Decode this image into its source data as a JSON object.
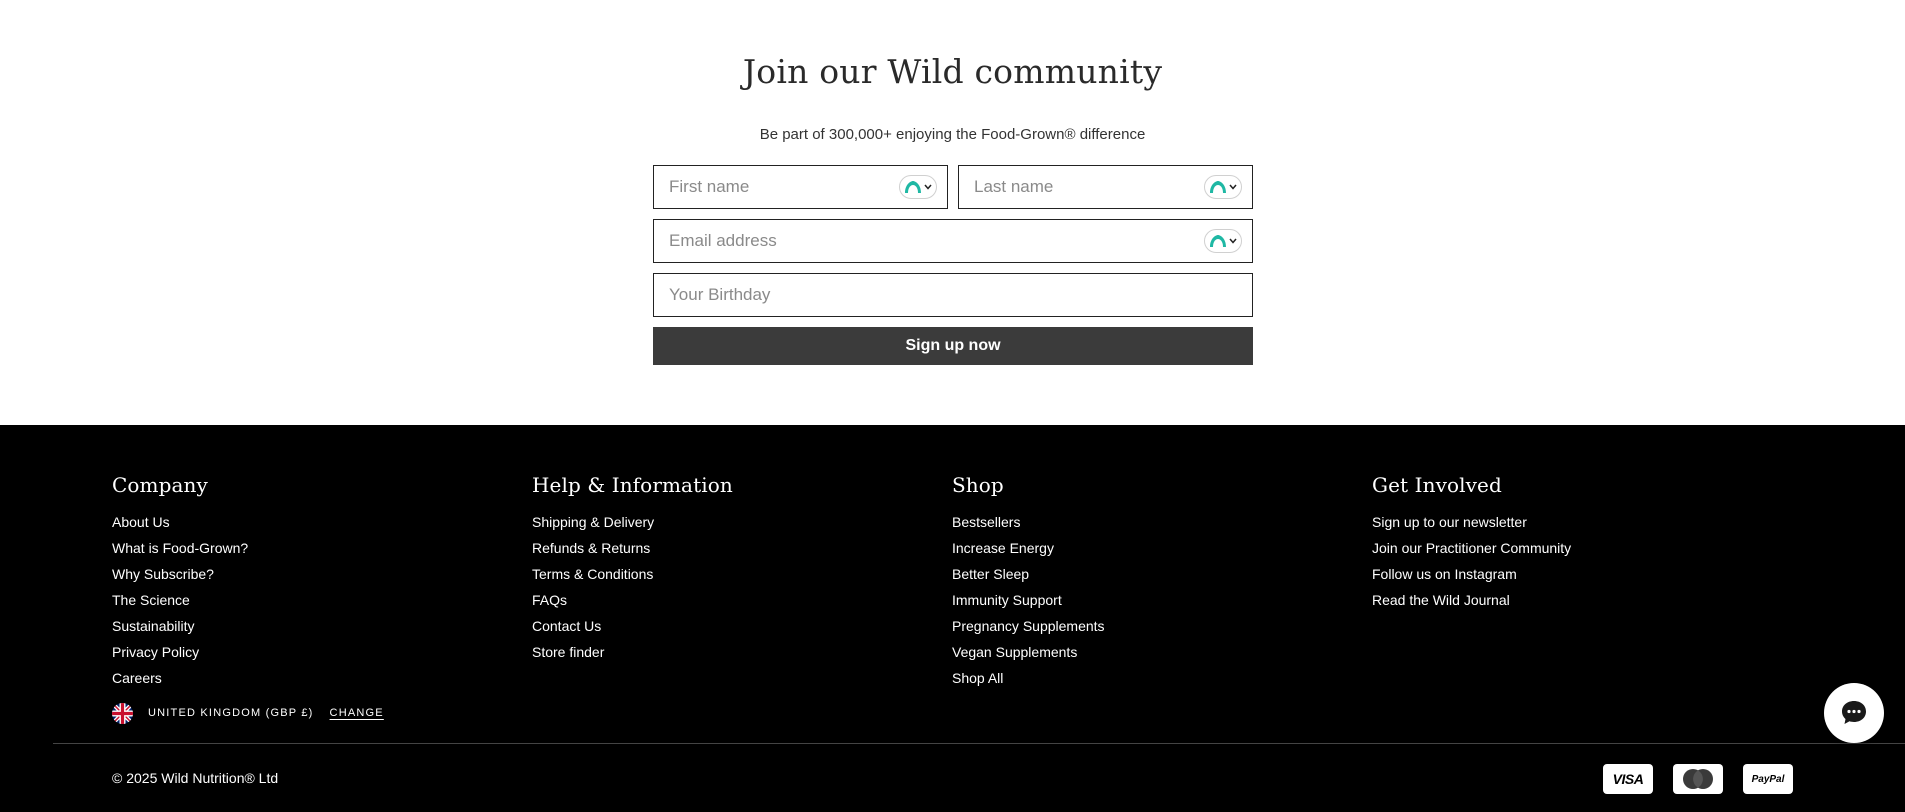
{
  "signup": {
    "title": "Join our Wild community",
    "subtitle": "Be part of 300,000+ enjoying the Food-Grown® difference",
    "first_name_placeholder": "First name",
    "last_name_placeholder": "Last name",
    "email_placeholder": "Email address",
    "birthday_placeholder": "Your Birthday",
    "submit_label": "Sign up now",
    "password_manager_icon": "password-manager-icon",
    "accent_color": "#1fb8a4"
  },
  "footer": {
    "columns": [
      {
        "heading": "Company",
        "links": [
          "About Us",
          "What is Food-Grown?",
          "Why Subscribe?",
          "The Science",
          "Sustainability",
          "Privacy Policy",
          "Careers"
        ]
      },
      {
        "heading": "Help & Information",
        "links": [
          "Shipping & Delivery",
          "Refunds & Returns",
          "Terms & Conditions",
          "FAQs",
          "Contact Us",
          "Store finder"
        ]
      },
      {
        "heading": "Shop",
        "links": [
          "Bestsellers",
          "Increase Energy",
          "Better Sleep",
          "Immunity Support",
          "Pregnancy Supplements",
          "Vegan Supplements",
          "Shop All"
        ]
      },
      {
        "heading": "Get Involved",
        "links": [
          "Sign up to our newsletter",
          "Join our Practitioner Community",
          "Follow us on Instagram",
          "Read the Wild Journal"
        ]
      }
    ],
    "locale": {
      "country": "UNITED KINGDOM (GBP £)",
      "change_label": "CHANGE",
      "flag_icon": "uk-flag-icon"
    },
    "copyright": "© 2025 Wild Nutrition® Ltd",
    "payment_methods": [
      "VISA",
      "Mastercard",
      "PayPal"
    ],
    "background_color": "#000000"
  },
  "chat": {
    "icon": "chat-bubble-icon"
  }
}
